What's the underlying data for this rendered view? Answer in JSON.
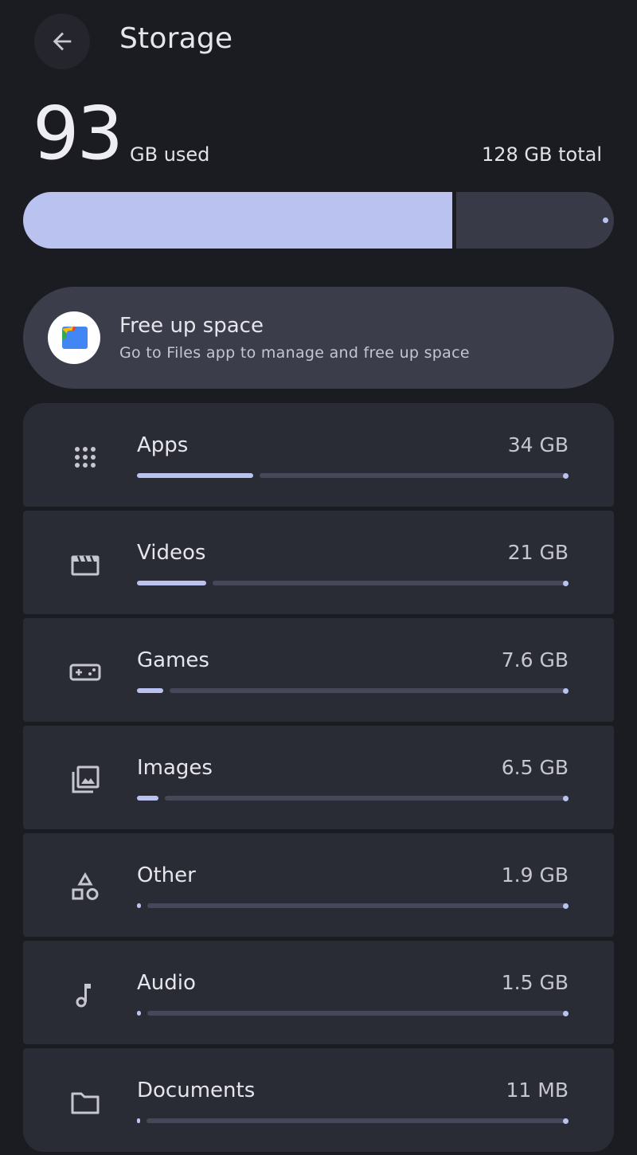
{
  "header": {
    "title": "Storage",
    "back_icon": "arrow-left-icon"
  },
  "summary": {
    "used_value": "93",
    "used_unit": "GB used",
    "total_label": "128 GB total",
    "used_fraction": 0.7266
  },
  "free_up": {
    "title": "Free up space",
    "subtitle": "Go to Files app to manage and free up space",
    "icon": "files-app-icon"
  },
  "categories": [
    {
      "label": "Apps",
      "size": "34 GB",
      "fraction": 0.27,
      "icon": "apps-grid-icon"
    },
    {
      "label": "Videos",
      "size": "21 GB",
      "fraction": 0.16,
      "icon": "movie-icon"
    },
    {
      "label": "Games",
      "size": "7.6 GB",
      "fraction": 0.06,
      "icon": "gamepad-icon"
    },
    {
      "label": "Images",
      "size": "6.5 GB",
      "fraction": 0.05,
      "icon": "image-icon"
    },
    {
      "label": "Other",
      "size": "1.9 GB",
      "fraction": 0.01,
      "icon": "shapes-icon"
    },
    {
      "label": "Audio",
      "size": "1.5 GB",
      "fraction": 0.01,
      "icon": "music-note-icon"
    },
    {
      "label": "Documents",
      "size": "11 MB",
      "fraction": 0.0,
      "icon": "folder-icon"
    }
  ],
  "colors": {
    "background": "#1b1c22",
    "accent": "#bac3f0",
    "card": "#2a2c35",
    "track": "#464859"
  }
}
